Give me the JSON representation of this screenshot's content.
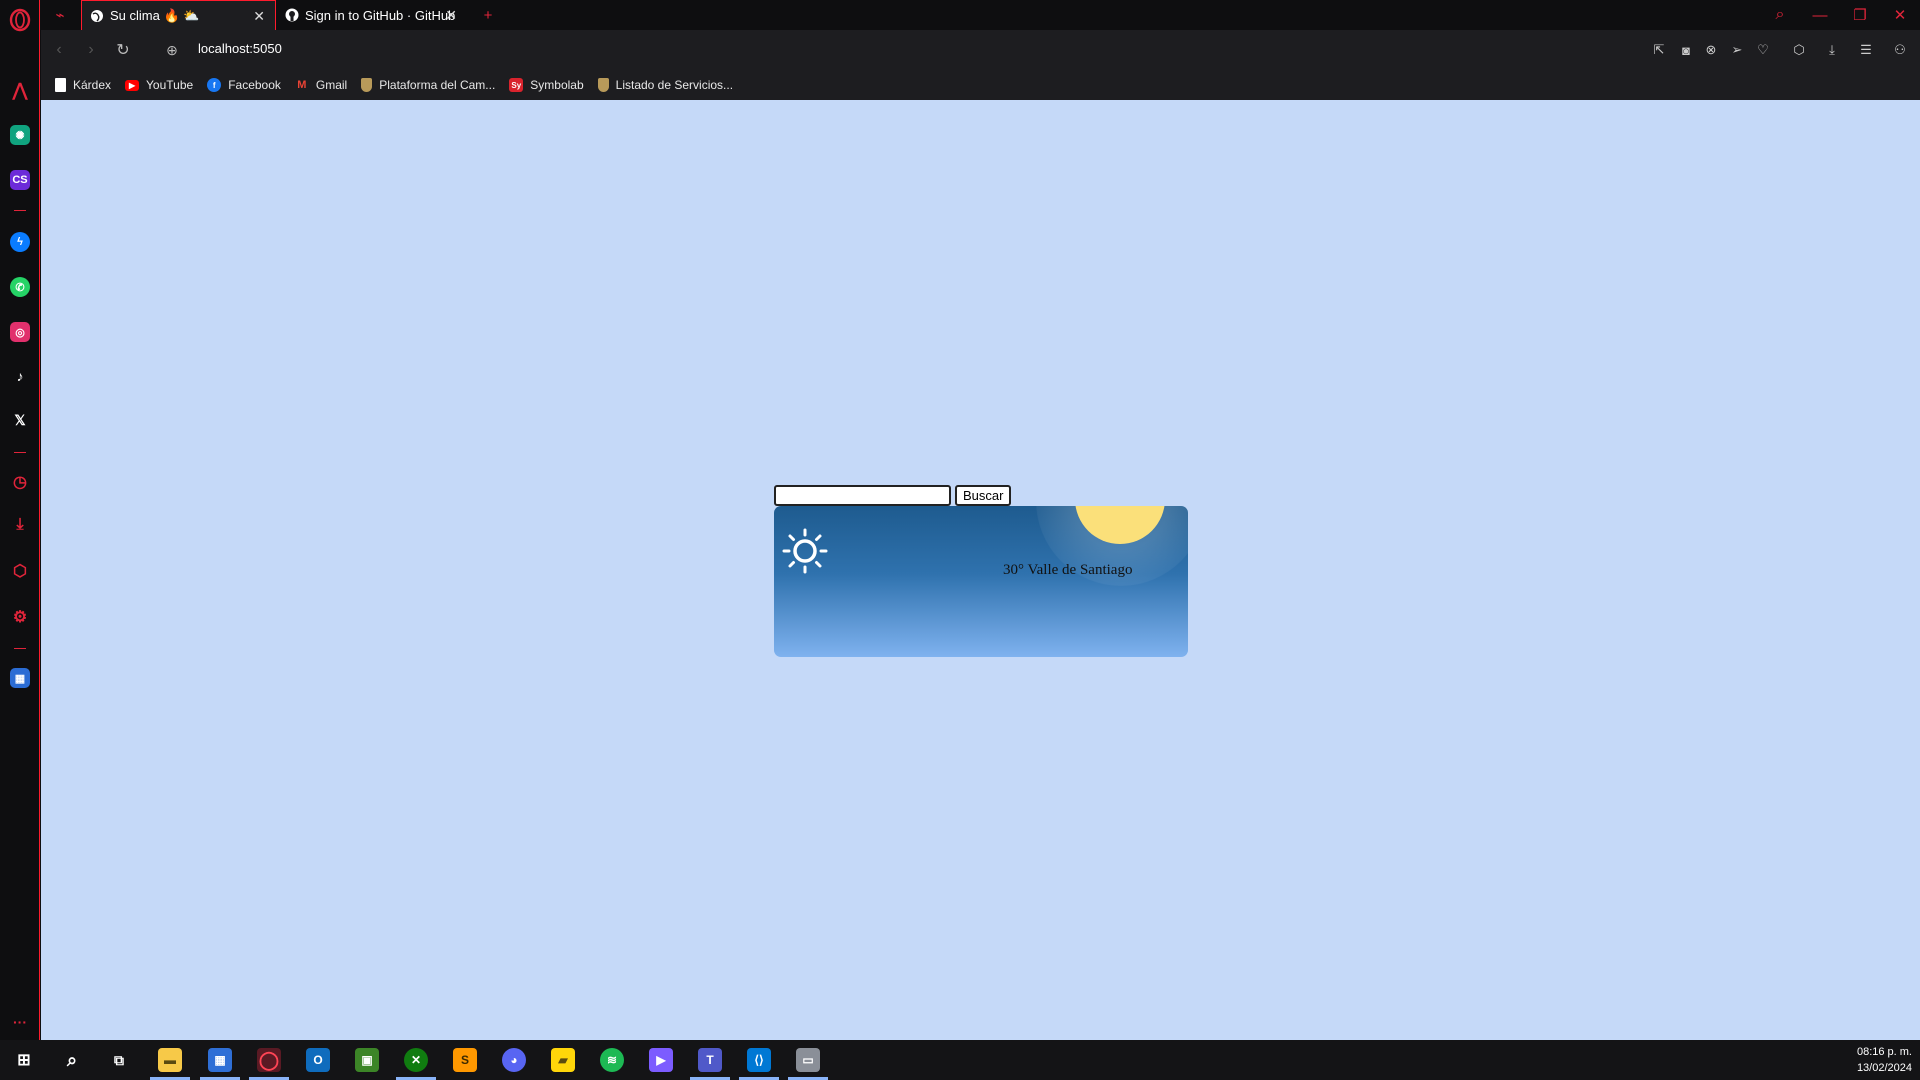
{
  "browser": {
    "tabs": [
      {
        "label": "Su clima 🔥 ⛅",
        "icon": "globe-icon",
        "active": true
      },
      {
        "label": "Sign in to GitHub · GitHub",
        "icon": "github-icon",
        "active": false
      }
    ],
    "new_tab_symbol": "+",
    "close_symbol": "✕",
    "url": "localhost:5050",
    "bookmarks": [
      {
        "label": "Kárdex",
        "icon": "document-icon",
        "color": "#ffffff"
      },
      {
        "label": "YouTube",
        "icon": "youtube-icon",
        "color": "#ff0000"
      },
      {
        "label": "Facebook",
        "icon": "facebook-icon",
        "color": "#1877f2"
      },
      {
        "label": "Gmail",
        "icon": "gmail-icon",
        "color": "#ea4335"
      },
      {
        "label": "Plataforma del Cam...",
        "icon": "shield-icon",
        "color": "#b89a5a"
      },
      {
        "label": "Symbolab",
        "icon": "symbolab-icon",
        "color": "#d9232d"
      },
      {
        "label": "Listado de Servicios...",
        "icon": "shield-icon",
        "color": "#b89a5a"
      }
    ],
    "symbolab_icon_text": "Sy",
    "accent": "#ff1b2d"
  },
  "sidebar": {
    "cs_text": "CS"
  },
  "page": {
    "background": "#c5d9f8",
    "search_placeholder": "",
    "search_button": "Buscar",
    "weather_text": "30° Valle de Santiago",
    "weather_icon": "sun-icon"
  },
  "taskbar": {
    "time": "08:16 p. m.",
    "date": "13/02/2024"
  }
}
